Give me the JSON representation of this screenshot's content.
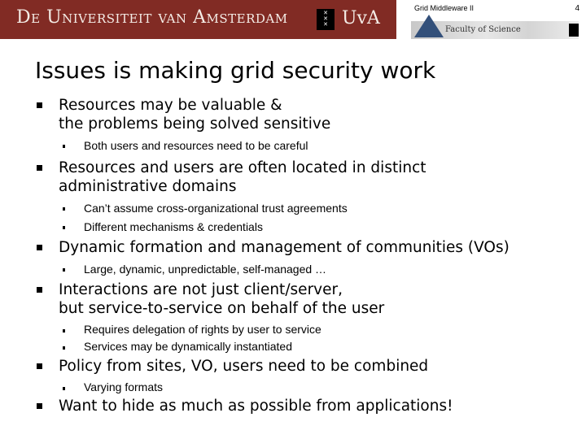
{
  "header": {
    "university": "De Universiteit van Amsterdam",
    "short_name": "UvA",
    "course": "Grid Middleware II",
    "page_number": "4",
    "faculty": "Faculty of Science",
    "brand_color": "#812b24"
  },
  "slide": {
    "title": "Issues is making grid security work",
    "bullets": [
      {
        "lines": [
          "Resources may be valuable &",
          "the problems being solved sensitive"
        ],
        "sub": [
          "Both users and resources need to be careful"
        ]
      },
      {
        "lines": [
          "Resources and users are often located in distinct",
          "administrative domains"
        ],
        "sub": [
          "Can’t assume cross-organizational trust agreements",
          "Different mechanisms & credentials"
        ]
      },
      {
        "lines": [
          "Dynamic formation and management of communities (VOs)"
        ],
        "sub": [
          "Large, dynamic, unpredictable, self-managed …"
        ]
      },
      {
        "lines": [
          "Interactions are not just client/server,",
          "but service-to-service on behalf of the user"
        ],
        "sub": [
          "Requires delegation of rights by user to service",
          "Services may be dynamically instantiated"
        ]
      },
      {
        "lines": [
          "Policy from sites, VO, users need to be combined"
        ],
        "sub": [
          "Varying formats"
        ]
      },
      {
        "lines": [
          "Want to hide as much as possible from applications!"
        ],
        "sub": []
      }
    ]
  }
}
